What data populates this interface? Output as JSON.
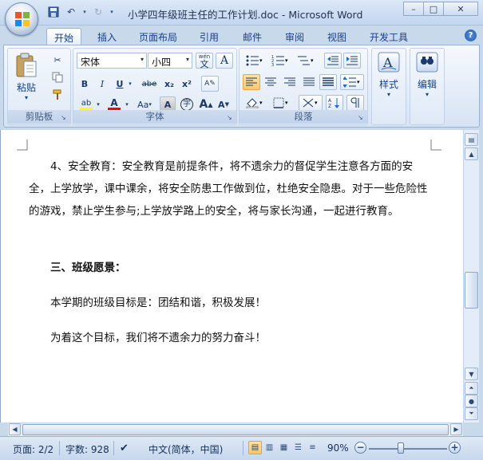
{
  "window": {
    "title": "小学四年级班主任的工作计划.doc - Microsoft Word",
    "controls": {
      "minimize": "–",
      "maximize": "□",
      "close": "✕"
    }
  },
  "quick_access": {
    "save_icon": "floppy-icon",
    "undo_icon": "undo-icon",
    "redo_icon": "redo-icon"
  },
  "tabs": [
    {
      "label": "开始",
      "active": true
    },
    {
      "label": "插入"
    },
    {
      "label": "页面布局"
    },
    {
      "label": "引用"
    },
    {
      "label": "邮件"
    },
    {
      "label": "审阅"
    },
    {
      "label": "视图"
    },
    {
      "label": "开发工具"
    }
  ],
  "help_label": "?",
  "ribbon": {
    "clipboard": {
      "label": "剪贴板",
      "paste_label": "粘贴",
      "paste_arrow": "▾"
    },
    "font": {
      "label": "字体",
      "font_name": "宋体",
      "font_size": "小四",
      "wen_label": "wén\n文",
      "A_label": "A",
      "bold": "B",
      "italic": "I",
      "underline": "U",
      "strike": "abe",
      "subscript": "x₂",
      "superscript": "x²",
      "highlight": "ab",
      "font_color": "A",
      "change_case": "Aa",
      "char_shade": "A",
      "enclose": "字",
      "grow": "A",
      "shrink": "A",
      "clear_fmt": "A"
    },
    "paragraph": {
      "label": "段落"
    },
    "styles": {
      "label": "样式",
      "arrow": "▾"
    },
    "editing": {
      "label": "编辑",
      "arrow": "▾"
    },
    "highlight_color": "#ffff00",
    "font_color_value": "#ff0000"
  },
  "document": {
    "paragraphs": [
      {
        "text": "　　4、安全教育：安全教育是前提条件，将不遗余力的督促学生注意各方面的安全，上学放学，课中课余，将安全防患工作做到位，杜绝安全隐患。对于一些危险性的游戏，禁止学生参与;上学放学路上的安全，将与家长沟通，一起进行教育。"
      },
      {
        "text": "　　三、班级愿景：",
        "heading": true
      },
      {
        "text": "　　本学期的班级目标是：团结和谐，积极发展！"
      },
      {
        "text": "　　为着这个目标，我们将不遗余力的努力奋斗！"
      }
    ]
  },
  "statusbar": {
    "page": "页面: 2/2",
    "words": "字数: 928",
    "language": "中文(简体，中国)",
    "zoom": "90%",
    "zoom_minus": "−",
    "zoom_plus": "+"
  }
}
